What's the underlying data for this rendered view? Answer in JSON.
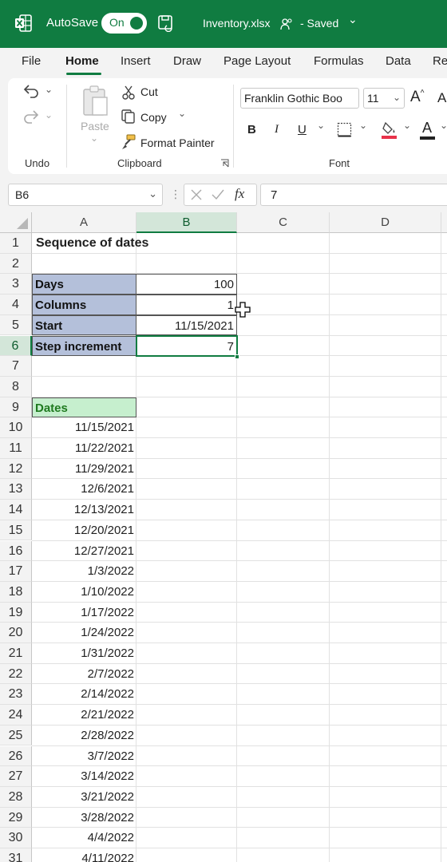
{
  "titlebar": {
    "autosave_label": "AutoSave",
    "toggle_label": "On",
    "filename": "Inventory.xlsx",
    "status": "- Saved",
    "status_arrow": "⌄"
  },
  "tabs": [
    "File",
    "Home",
    "Insert",
    "Draw",
    "Page Layout",
    "Formulas",
    "Data",
    "Re"
  ],
  "ribbon": {
    "undo_label": "Undo",
    "clipboard_label": "Clipboard",
    "font_label": "Font",
    "paste": "Paste",
    "cut": "Cut",
    "copy": "Copy",
    "format_painter": "Format Painter",
    "font_name": "Franklin Gothic Boo",
    "font_size": "11",
    "bold": "B",
    "italic": "I",
    "underline": "U",
    "font_color_letter": "A"
  },
  "formula_bar": {
    "name_box": "B6",
    "fx": "fx",
    "formula": "7"
  },
  "columns": [
    "A",
    "B",
    "C",
    "D"
  ],
  "rows": [
    "1",
    "2",
    "3",
    "4",
    "5",
    "6",
    "7",
    "8",
    "9",
    "10",
    "11",
    "12",
    "13",
    "14",
    "15",
    "16",
    "17",
    "18",
    "19",
    "20",
    "21",
    "22",
    "23",
    "24",
    "25",
    "26",
    "27",
    "28",
    "29",
    "30",
    "31"
  ],
  "sheet": {
    "title": "Sequence of dates",
    "params": [
      {
        "label": "Days",
        "value": "100"
      },
      {
        "label": "Columns",
        "value": "1"
      },
      {
        "label": "Start",
        "value": "11/15/2021"
      },
      {
        "label": "Step increment",
        "value": "7"
      }
    ],
    "dates_header": "Dates",
    "dates": [
      "11/15/2021",
      "11/22/2021",
      "11/29/2021",
      "12/6/2021",
      "12/13/2021",
      "12/20/2021",
      "12/27/2021",
      "1/3/2022",
      "1/10/2022",
      "1/17/2022",
      "1/24/2022",
      "1/31/2022",
      "2/7/2022",
      "2/14/2022",
      "2/21/2022",
      "2/28/2022",
      "3/7/2022",
      "3/14/2022",
      "3/21/2022",
      "3/28/2022",
      "4/4/2022",
      "4/11/2022"
    ]
  },
  "colors": {
    "brand": "#107c41",
    "label_fill": "#b4c0da",
    "dates_header_fill": "#c6efce"
  }
}
